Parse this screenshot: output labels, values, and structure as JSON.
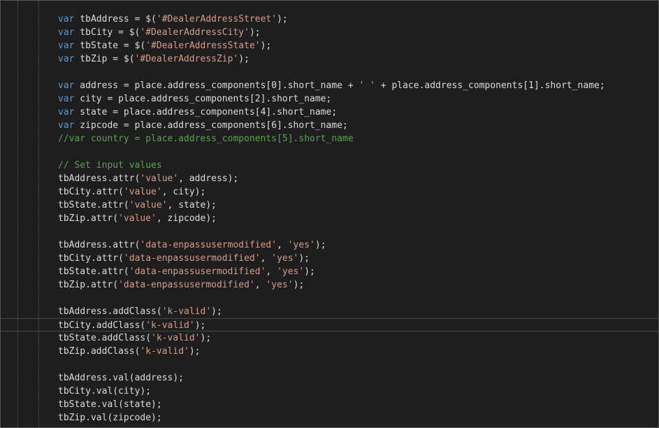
{
  "colors": {
    "background": "#1e1e1e",
    "plain": "#dcdcdc",
    "keyword": "#569cd6",
    "string": "#d69d85",
    "comment": "#57a64a"
  },
  "editor": {
    "current_line_index": 23,
    "lines": [
      [
        [
          "keyword",
          "var"
        ],
        [
          "plain",
          " tbAddress = $("
        ],
        [
          "string",
          "'#DealerAddressStreet'"
        ],
        [
          "plain",
          ");"
        ]
      ],
      [
        [
          "keyword",
          "var"
        ],
        [
          "plain",
          " tbCity = $("
        ],
        [
          "string",
          "'#DealerAddressCity'"
        ],
        [
          "plain",
          ");"
        ]
      ],
      [
        [
          "keyword",
          "var"
        ],
        [
          "plain",
          " tbState = $("
        ],
        [
          "string",
          "'#DealerAddressState'"
        ],
        [
          "plain",
          ");"
        ]
      ],
      [
        [
          "keyword",
          "var"
        ],
        [
          "plain",
          " tbZip = $("
        ],
        [
          "string",
          "'#DealerAddressZip'"
        ],
        [
          "plain",
          ");"
        ]
      ],
      [],
      [
        [
          "keyword",
          "var"
        ],
        [
          "plain",
          " address = place.address_components[0].short_name + "
        ],
        [
          "string",
          "' '"
        ],
        [
          "plain",
          " + place.address_components[1].short_name;"
        ]
      ],
      [
        [
          "keyword",
          "var"
        ],
        [
          "plain",
          " city = place.address_components[2].short_name;"
        ]
      ],
      [
        [
          "keyword",
          "var"
        ],
        [
          "plain",
          " state = place.address_components[4].short_name;"
        ]
      ],
      [
        [
          "keyword",
          "var"
        ],
        [
          "plain",
          " zipcode = place.address_components[6].short_name;"
        ]
      ],
      [
        [
          "comment",
          "//var country = place.address_components[5].short_name"
        ]
      ],
      [],
      [
        [
          "comment",
          "// Set input values"
        ]
      ],
      [
        [
          "plain",
          "tbAddress.attr("
        ],
        [
          "string",
          "'value'"
        ],
        [
          "plain",
          ", address);"
        ]
      ],
      [
        [
          "plain",
          "tbCity.attr("
        ],
        [
          "string",
          "'value'"
        ],
        [
          "plain",
          ", city);"
        ]
      ],
      [
        [
          "plain",
          "tbState.attr("
        ],
        [
          "string",
          "'value'"
        ],
        [
          "plain",
          ", state);"
        ]
      ],
      [
        [
          "plain",
          "tbZip.attr("
        ],
        [
          "string",
          "'value'"
        ],
        [
          "plain",
          ", zipcode);"
        ]
      ],
      [],
      [
        [
          "plain",
          "tbAddress.attr("
        ],
        [
          "string",
          "'data-enpassusermodified'"
        ],
        [
          "plain",
          ", "
        ],
        [
          "string",
          "'yes'"
        ],
        [
          "plain",
          ");"
        ]
      ],
      [
        [
          "plain",
          "tbCity.attr("
        ],
        [
          "string",
          "'data-enpassusermodified'"
        ],
        [
          "plain",
          ", "
        ],
        [
          "string",
          "'yes'"
        ],
        [
          "plain",
          ");"
        ]
      ],
      [
        [
          "plain",
          "tbState.attr("
        ],
        [
          "string",
          "'data-enpassusermodified'"
        ],
        [
          "plain",
          ", "
        ],
        [
          "string",
          "'yes'"
        ],
        [
          "plain",
          ");"
        ]
      ],
      [
        [
          "plain",
          "tbZip.attr("
        ],
        [
          "string",
          "'data-enpassusermodified'"
        ],
        [
          "plain",
          ", "
        ],
        [
          "string",
          "'yes'"
        ],
        [
          "plain",
          ");"
        ]
      ],
      [],
      [
        [
          "plain",
          "tbAddress.addClass("
        ],
        [
          "string",
          "'k-valid'"
        ],
        [
          "plain",
          ");"
        ]
      ],
      [
        [
          "plain",
          "tbCity.addClass("
        ],
        [
          "string",
          "'k-valid'"
        ],
        [
          "plain",
          ");"
        ]
      ],
      [
        [
          "plain",
          "tbState.addClass("
        ],
        [
          "string",
          "'k-valid'"
        ],
        [
          "plain",
          ");"
        ]
      ],
      [
        [
          "plain",
          "tbZip.addClass("
        ],
        [
          "string",
          "'k-valid'"
        ],
        [
          "plain",
          ");"
        ]
      ],
      [],
      [
        [
          "plain",
          "tbAddress.val(address);"
        ]
      ],
      [
        [
          "plain",
          "tbCity.val(city);"
        ]
      ],
      [
        [
          "plain",
          "tbState.val(state);"
        ]
      ],
      [
        [
          "plain",
          "tbZip.val(zipcode);"
        ]
      ]
    ]
  }
}
